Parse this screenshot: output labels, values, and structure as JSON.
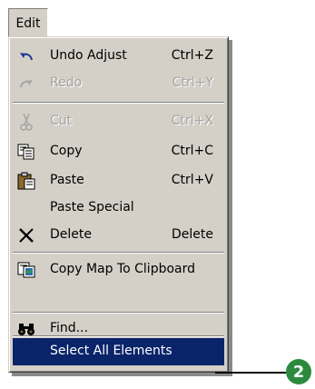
{
  "menubar": {
    "edit_label": "Edit"
  },
  "menu": {
    "items": [
      {
        "label": "Undo Adjust",
        "shortcut": "Ctrl+Z",
        "icon": "undo-icon",
        "enabled": true
      },
      {
        "label": "Redo",
        "shortcut": "Ctrl+Y",
        "icon": "redo-icon",
        "enabled": false
      },
      {
        "label": "Cut",
        "shortcut": "Ctrl+X",
        "icon": "scissors-icon",
        "enabled": false
      },
      {
        "label": "Copy",
        "shortcut": "Ctrl+C",
        "icon": "copy-icon",
        "enabled": true
      },
      {
        "label": "Paste",
        "shortcut": "Ctrl+V",
        "icon": "paste-icon",
        "enabled": true
      },
      {
        "label": "Paste Special",
        "shortcut": "",
        "icon": "",
        "enabled": true
      },
      {
        "label": "Delete",
        "shortcut": "Delete",
        "icon": "delete-x-icon",
        "enabled": true
      },
      {
        "label": "Copy Map To Clipboard",
        "shortcut": "",
        "icon": "copy-map-icon",
        "enabled": true
      },
      {
        "label": "Find...",
        "shortcut": "",
        "icon": "binoculars-icon",
        "enabled": true
      },
      {
        "label": "Select All Elements",
        "shortcut": "",
        "icon": "",
        "enabled": true,
        "selected": true
      }
    ]
  },
  "callout": {
    "number": "2"
  },
  "colors": {
    "menu_bg": "#d4d0c8",
    "highlight": "#0a246a",
    "callout": "#2b8a3e",
    "disabled_text": "#a4a4a4"
  }
}
